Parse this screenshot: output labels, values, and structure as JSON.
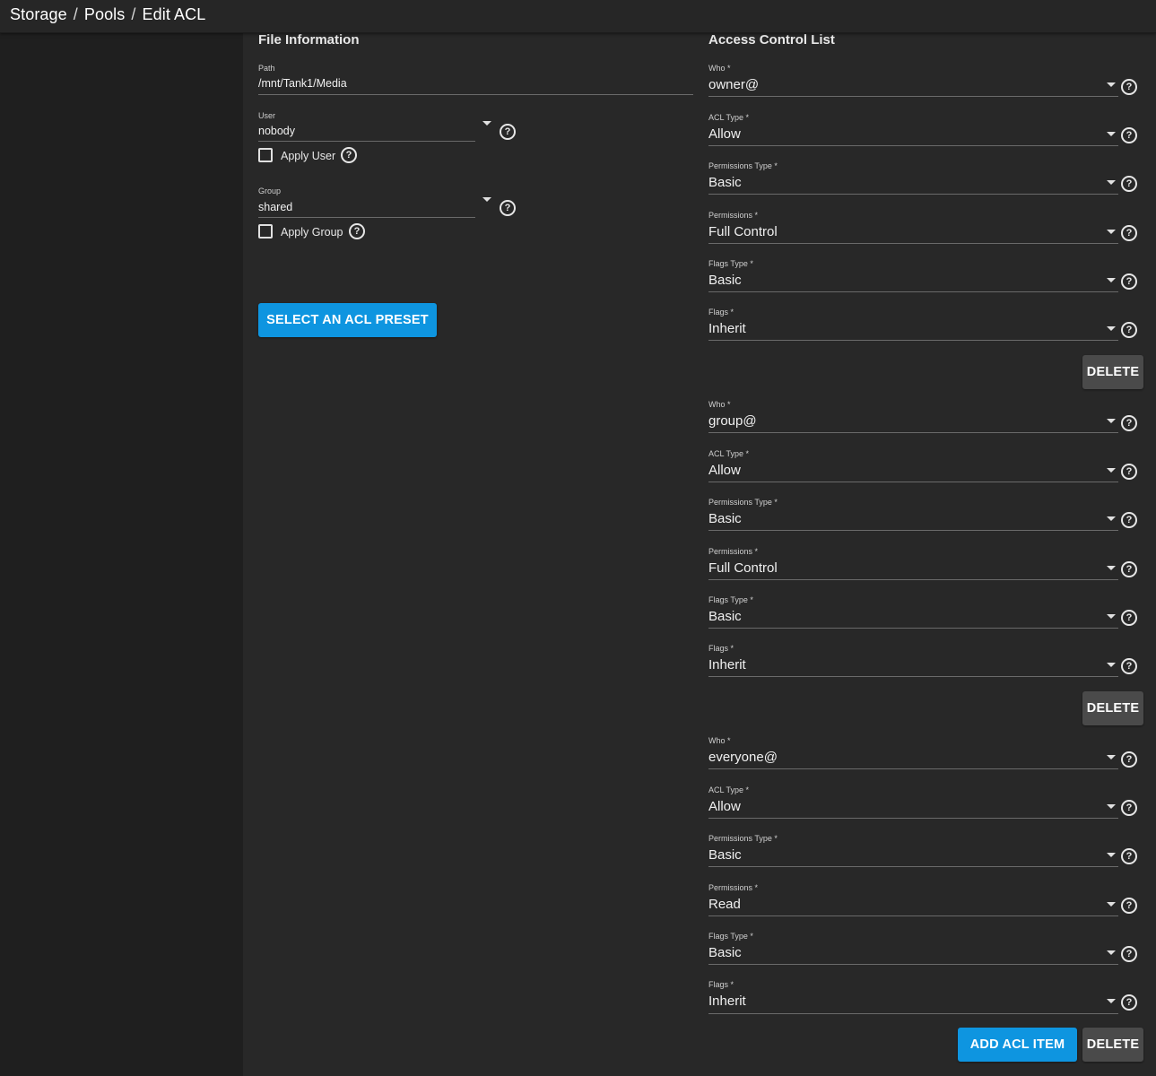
{
  "breadcrumb": {
    "items": [
      "Storage",
      "Pools",
      "Edit ACL"
    ],
    "separator": "/"
  },
  "file_info": {
    "title": "File Information",
    "path_label": "Path",
    "path_value": "/mnt/Tank1/Media",
    "user_label": "User",
    "user_value": "nobody",
    "apply_user_label": "Apply User",
    "group_label": "Group",
    "group_value": "shared",
    "apply_group_label": "Apply Group",
    "preset_button": "SELECT AN ACL PRESET"
  },
  "acl": {
    "title": "Access Control List",
    "items": [
      {
        "fields": [
          {
            "label": "Who *",
            "value": "owner@"
          },
          {
            "label": "ACL Type *",
            "value": "Allow"
          },
          {
            "label": "Permissions Type *",
            "value": "Basic"
          },
          {
            "label": "Permissions *",
            "value": "Full Control"
          },
          {
            "label": "Flags Type *",
            "value": "Basic"
          },
          {
            "label": "Flags *",
            "value": "Inherit"
          }
        ],
        "delete_label": "DELETE"
      },
      {
        "fields": [
          {
            "label": "Who *",
            "value": "group@"
          },
          {
            "label": "ACL Type *",
            "value": "Allow"
          },
          {
            "label": "Permissions Type *",
            "value": "Basic"
          },
          {
            "label": "Permissions *",
            "value": "Full Control"
          },
          {
            "label": "Flags Type *",
            "value": "Basic"
          },
          {
            "label": "Flags *",
            "value": "Inherit"
          }
        ],
        "delete_label": "DELETE"
      },
      {
        "fields": [
          {
            "label": "Who *",
            "value": "everyone@"
          },
          {
            "label": "ACL Type *",
            "value": "Allow"
          },
          {
            "label": "Permissions Type *",
            "value": "Basic"
          },
          {
            "label": "Permissions *",
            "value": "Read"
          },
          {
            "label": "Flags Type *",
            "value": "Basic"
          },
          {
            "label": "Flags *",
            "value": "Inherit"
          }
        ],
        "delete_label": "DELETE"
      }
    ],
    "add_button": "ADD ACL ITEM"
  },
  "icons": {
    "help": "help-circle-icon",
    "caret": "caret-down-icon",
    "checkbox": "checkbox-unchecked-icon"
  },
  "colors": {
    "background": "#282828",
    "sidebar": "#1f1f1f",
    "primary_button": "#0e95e0",
    "secondary_button": "#4a4a4a"
  }
}
